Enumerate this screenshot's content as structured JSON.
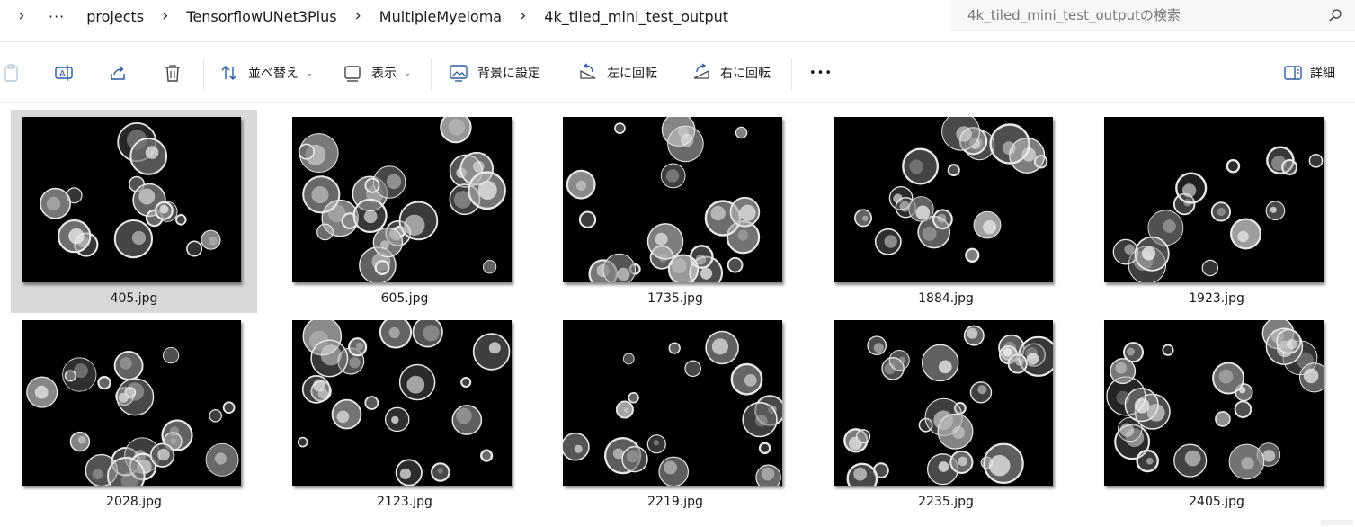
{
  "breadcrumb": {
    "items": [
      "projects",
      "TensorflowUNet3Plus",
      "MultipleMyeloma",
      "4k_tiled_mini_test_output"
    ]
  },
  "search": {
    "placeholder": "4k_tiled_mini_test_outputの検索"
  },
  "toolbar": {
    "sort_label": "並べ替え",
    "view_label": "表示",
    "set_background_label": "背景に設定",
    "rotate_left_label": "左に回転",
    "rotate_right_label": "右に回転",
    "more_label": "•••",
    "details_label": "詳細"
  },
  "files": [
    {
      "name": "405.jpg",
      "selected": true
    },
    {
      "name": "605.jpg",
      "selected": false
    },
    {
      "name": "1735.jpg",
      "selected": false
    },
    {
      "name": "1884.jpg",
      "selected": false
    },
    {
      "name": "1923.jpg",
      "selected": false
    },
    {
      "name": "2028.jpg",
      "selected": false
    },
    {
      "name": "2123.jpg",
      "selected": false
    },
    {
      "name": "2219.jpg",
      "selected": false
    },
    {
      "name": "2235.jpg",
      "selected": false
    },
    {
      "name": "2405.jpg",
      "selected": false
    }
  ]
}
